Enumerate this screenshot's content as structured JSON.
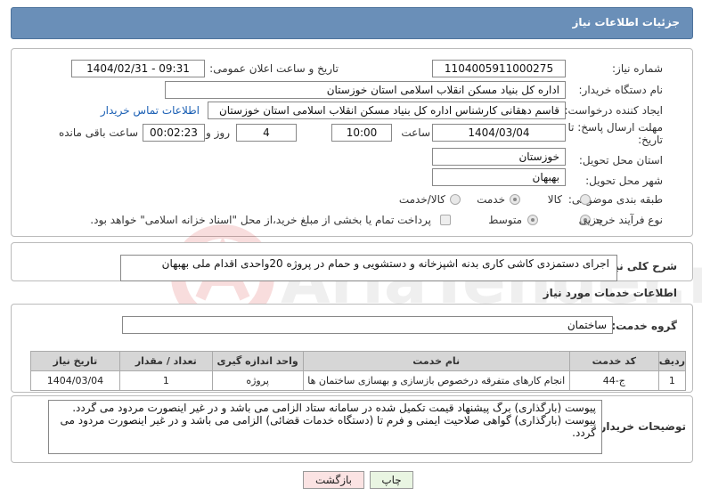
{
  "header": {
    "title": "جزئیات اطلاعات نیاز"
  },
  "form": {
    "need_number_label": "شماره نیاز:",
    "need_number": "1104005911000275",
    "announce_label": "تاریخ و ساعت اعلان عمومی:",
    "announce_value": "1404/02/31 - 09:31",
    "buyer_label": "نام دستگاه خریدار:",
    "buyer_value": "اداره کل بنیاد مسکن انقلاب اسلامی استان خوزستان",
    "creator_label": "ایجاد کننده درخواست:",
    "creator_value": "قاسم دهقانی کارشناس اداره کل بنیاد مسکن انقلاب اسلامی استان خوزستان",
    "contact_link": "اطلاعات تماس خریدار",
    "deadline_label_line1": "مهلت ارسال پاسخ: تا",
    "deadline_label_line2": "تاریخ:",
    "deadline_date": "1404/03/04",
    "time_label": "ساعت",
    "deadline_time": "10:00",
    "days_value": "4",
    "days_label": "روز و",
    "remaining_value": "00:02:23",
    "remaining_label": "ساعت باقی مانده",
    "province_label": "استان محل تحویل:",
    "province_value": "خوزستان",
    "city_label": "شهر محل تحویل:",
    "city_value": "بهبهان",
    "category_label": "طبقه بندی موضوعی:",
    "category_options": [
      "کالا",
      "خدمت",
      "کالا/خدمت"
    ],
    "category_selected": "خدمت",
    "process_label": "نوع فرآیند خرید :",
    "process_options": [
      "جزیی",
      "متوسط"
    ],
    "process_selected": "جزیی",
    "payment_note": "پرداخت تمام یا بخشی از مبلغ خرید،از محل \"اسناد خزانه اسلامی\" خواهد بود."
  },
  "summary": {
    "label": "شرح کلی نیاز:",
    "text": "اجرای دستمزدی کاشی کاری  بدنه اشپزخانه و دستشویی و حمام  در  پروژه 20واحدی اقدام ملی بهبهان"
  },
  "services": {
    "section_title": "اطلاعات خدمات مورد نیاز",
    "group_label": "گروه خدمت:",
    "group_value": "ساختمان",
    "columns": [
      "ردیف",
      "کد خدمت",
      "نام خدمت",
      "واحد اندازه گیری",
      "تعداد / مقدار",
      "تاریخ نیاز"
    ],
    "rows": [
      [
        "1",
        "ج-44",
        "انجام کارهای متفرقه درخصوص بازسازی و بهسازی ساختمان ها",
        "پروژه",
        "1",
        "1404/03/04"
      ]
    ]
  },
  "notes": {
    "label": "توضیحات خریدار:",
    "text": "پیوست (بارگذاری) برگ پیشنهاد قیمت تکمیل شده در سامانه ستاد الزامی می باشد و در غیر اینصورت مردود می گردد.\nپیوست (بارگذاری) گواهی صلاحیت ایمنی و فرم تا (دستگاه خدمات قضائی) الزامی می باشد و در غیر اینصورت مردود می گردد."
  },
  "buttons": {
    "print": "چاپ",
    "back": "بازگشت"
  },
  "watermark": {
    "text": "AriaTender.neT"
  },
  "colors": {
    "header": "#6a8fb8",
    "print_button": "#e9f5e2",
    "back_button": "#fbe3e3",
    "link": "#1a5fb4"
  }
}
